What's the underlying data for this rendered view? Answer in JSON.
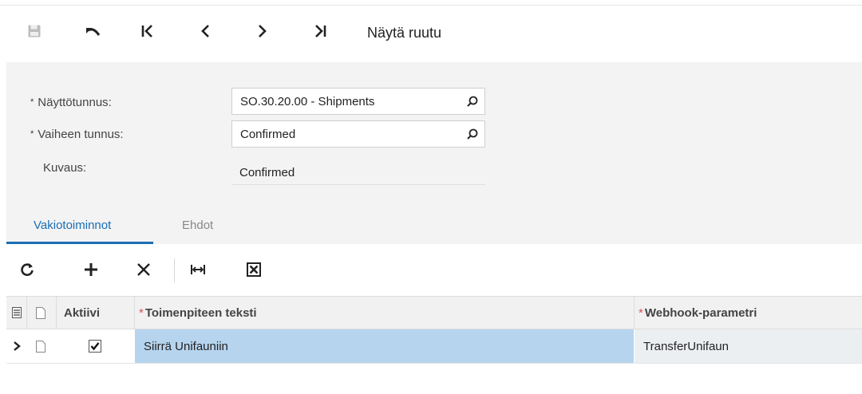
{
  "toolbar": {
    "title": "Näytä ruutu",
    "icons": [
      "save-icon",
      "undo-icon",
      "first-record-icon",
      "previous-record-icon",
      "next-record-icon",
      "last-record-icon"
    ]
  },
  "form": {
    "screen_id": {
      "label": "Näyttötunnus:",
      "value": "SO.30.20.00 - Shipments",
      "required": "*"
    },
    "step_id": {
      "label": "Vaiheen tunnus:",
      "value": "Confirmed",
      "required": "*"
    },
    "description": {
      "label": "Kuvaus:",
      "value": "Confirmed"
    }
  },
  "tabs": [
    {
      "label": "Vakiotoiminnot",
      "active": true
    },
    {
      "label": "Ehdot",
      "active": false
    }
  ],
  "grid_toolbar": {
    "icons": [
      "refresh-icon",
      "add-icon",
      "delete-icon",
      "fit-columns-icon",
      "export-excel-icon"
    ]
  },
  "grid": {
    "columns": [
      "Aktiivi",
      "Toimenpiteen teksti",
      "Webhook-parametri"
    ],
    "required_mark": "*",
    "rows": [
      {
        "active": true,
        "action_text": "Siirrä Unifauniin",
        "webhook_param": "TransferUnifaun"
      }
    ]
  },
  "colors": {
    "accent": "#1a6fb5",
    "selected_cell": "#b6d4ee",
    "required_star": "#d9534f"
  }
}
